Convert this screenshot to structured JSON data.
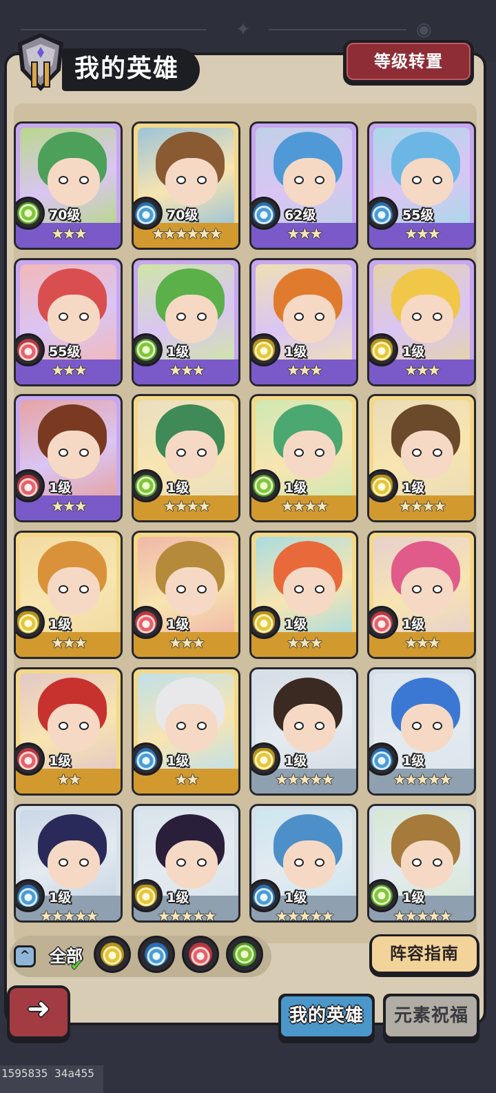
{
  "header": {
    "title": "我的英雄",
    "level_transfer_label": "等级转置"
  },
  "heroes": [
    {
      "level": "70级",
      "element": "wind",
      "stars": "★★★",
      "rarity": "epic",
      "art_color": "#b8d88a",
      "hair": "#4ca05a"
    },
    {
      "level": "70级",
      "element": "water",
      "stars": "★★★★★★",
      "rarity": "legend",
      "art_color": "#9cc3d9",
      "hair": "#8a5a32"
    },
    {
      "level": "62级",
      "element": "water",
      "stars": "★★★",
      "rarity": "epic",
      "art_color": "#bfd1e6",
      "hair": "#4f9ad6"
    },
    {
      "level": "55级",
      "element": "water",
      "stars": "★★★",
      "rarity": "epic",
      "art_color": "#a9d9e8",
      "hair": "#6cb6e6"
    },
    {
      "level": "55级",
      "element": "fire",
      "stars": "★★★",
      "rarity": "epic",
      "art_color": "#f2b8b8",
      "hair": "#d94f4f"
    },
    {
      "level": "1级",
      "element": "wind",
      "stars": "★★★",
      "rarity": "epic",
      "art_color": "#cfe6a4",
      "hair": "#5bb04a"
    },
    {
      "level": "1级",
      "element": "earth",
      "stars": "★★★",
      "rarity": "epic",
      "art_color": "#efe0b3",
      "hair": "#e07b2e"
    },
    {
      "level": "1级",
      "element": "earth",
      "stars": "★★★",
      "rarity": "epic",
      "art_color": "#e5d3a8",
      "hair": "#f1c74a"
    },
    {
      "level": "1级",
      "element": "fire",
      "stars": "★★★",
      "rarity": "epic",
      "art_color": "#e6a3a3",
      "hair": "#7a3a22"
    },
    {
      "level": "1级",
      "element": "wind",
      "stars": "★★★★",
      "rarity": "legend",
      "art_color": "#e9dfc1",
      "hair": "#3f8a57"
    },
    {
      "level": "1级",
      "element": "wind",
      "stars": "★★★★",
      "rarity": "legend",
      "art_color": "#cfe8b4",
      "hair": "#4aa870"
    },
    {
      "level": "1级",
      "element": "earth",
      "stars": "★★★★",
      "rarity": "legend",
      "art_color": "#eadcb8",
      "hair": "#6b4a2c"
    },
    {
      "level": "1级",
      "element": "earth",
      "stars": "★★★",
      "rarity": "legend",
      "art_color": "#f2dba2",
      "hair": "#d9923a"
    },
    {
      "level": "1级",
      "element": "fire",
      "stars": "★★★",
      "rarity": "legend",
      "art_color": "#f0b7a8",
      "hair": "#b58a3a"
    },
    {
      "level": "1级",
      "element": "earth",
      "stars": "★★★",
      "rarity": "legend",
      "art_color": "#a9dce0",
      "hair": "#e86a3a"
    },
    {
      "level": "1级",
      "element": "fire",
      "stars": "★★★",
      "rarity": "legend",
      "art_color": "#e6d0cf",
      "hair": "#e05a8a"
    },
    {
      "level": "1级",
      "element": "fire",
      "stars": "★★",
      "rarity": "legend",
      "art_color": "#e3c8c6",
      "hair": "#c8322e"
    },
    {
      "level": "1级",
      "element": "water",
      "stars": "★★",
      "rarity": "legend",
      "art_color": "#bfe0ea",
      "hair": "#e8e8ea"
    },
    {
      "level": "1级",
      "element": "earth",
      "stars": "★★★★★",
      "rarity": "rare",
      "art_color": "#d6dde6",
      "hair": "#3a2a22"
    },
    {
      "level": "1级",
      "element": "water",
      "stars": "★★★★★",
      "rarity": "rare",
      "art_color": "#dce6ee",
      "hair": "#3b78d4"
    },
    {
      "level": "1级",
      "element": "water",
      "stars": "★★★★★",
      "rarity": "rare",
      "art_color": "#c9d6e6",
      "hair": "#2a2a5a"
    },
    {
      "level": "1级",
      "element": "earth",
      "stars": "★★★★★",
      "rarity": "rare",
      "art_color": "#d9e4ec",
      "hair": "#2a1f3a"
    },
    {
      "level": "1级",
      "element": "water",
      "stars": "★★★★★",
      "rarity": "rare",
      "art_color": "#cde6f0",
      "hair": "#4d8fc9"
    },
    {
      "level": "1级",
      "element": "wind",
      "stars": "★★★★★",
      "rarity": "rare",
      "art_color": "#d6e8d4",
      "hair": "#a67a3a"
    }
  ],
  "filter": {
    "collapse_icon": "^",
    "all_label": "全部",
    "all_selected": true,
    "elements": [
      "earth",
      "water",
      "fire",
      "wind"
    ]
  },
  "lineup_guide_label": "阵容指南",
  "tabs": [
    {
      "label": "我的英雄",
      "active": true
    },
    {
      "label": "元素祝福",
      "active": false
    }
  ],
  "back_icon": "back-arrow",
  "footer_id": "1595835 34a455",
  "colors": {
    "panel": "#d9ccb4",
    "epic_frame": "#a98cd6",
    "legend_frame": "#e9c36a",
    "rare_frame": "#b9c7d3",
    "accent_red": "#8e2d35",
    "tab_active": "#4c97c9"
  }
}
